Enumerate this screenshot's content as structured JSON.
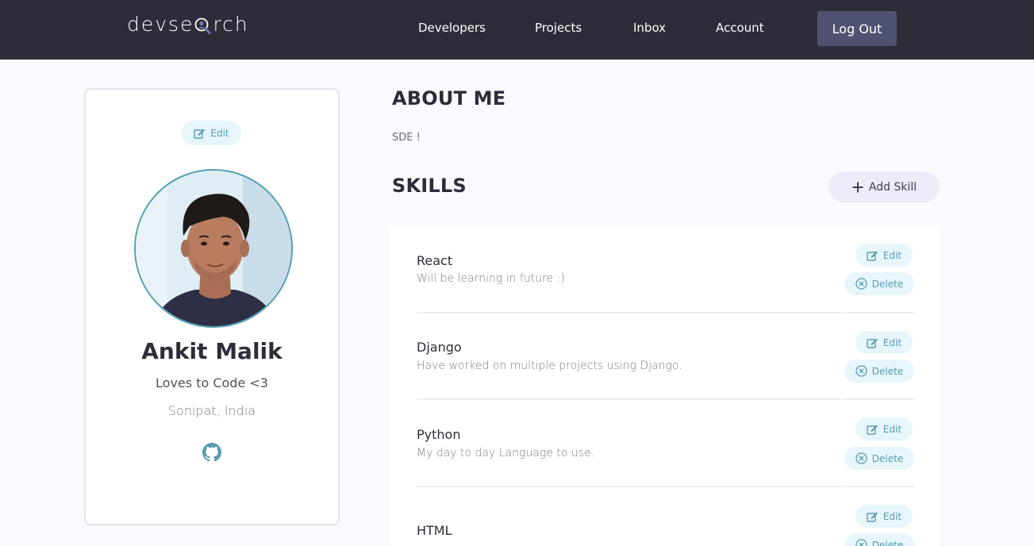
{
  "navbar": {
    "logo_text_start": "devse",
    "logo_text_end": "rch",
    "links": [
      {
        "label": "Developers"
      },
      {
        "label": "Projects"
      },
      {
        "label": "Inbox"
      },
      {
        "label": "Account"
      }
    ],
    "logout_label": "Log Out"
  },
  "profile": {
    "edit_label": "Edit",
    "name": "Ankit Malik",
    "tagline": "Loves to Code <3",
    "location": "Sonipat, India",
    "social_icon": "github-icon"
  },
  "about": {
    "title": "ABOUT ME",
    "text": "SDE !"
  },
  "skills": {
    "title": "SKILLS",
    "add_label": "Add Skill",
    "edit_label": "Edit",
    "delete_label": "Delete",
    "items": [
      {
        "name": "React",
        "description": "Will be learning in future :)"
      },
      {
        "name": "Django",
        "description": "Have worked on multiple projects using Django."
      },
      {
        "name": "Python",
        "description": "My day to day Language to use."
      },
      {
        "name": "HTML",
        "description": ""
      }
    ]
  },
  "colors": {
    "navbar_bg": "#2d2d39",
    "logout_bg": "#4f5270",
    "page_bg": "#f8fafe",
    "pill_bg": "#e6f6fb",
    "pill_text": "#5a9bb1",
    "add_skill_bg": "#ecebf7"
  }
}
